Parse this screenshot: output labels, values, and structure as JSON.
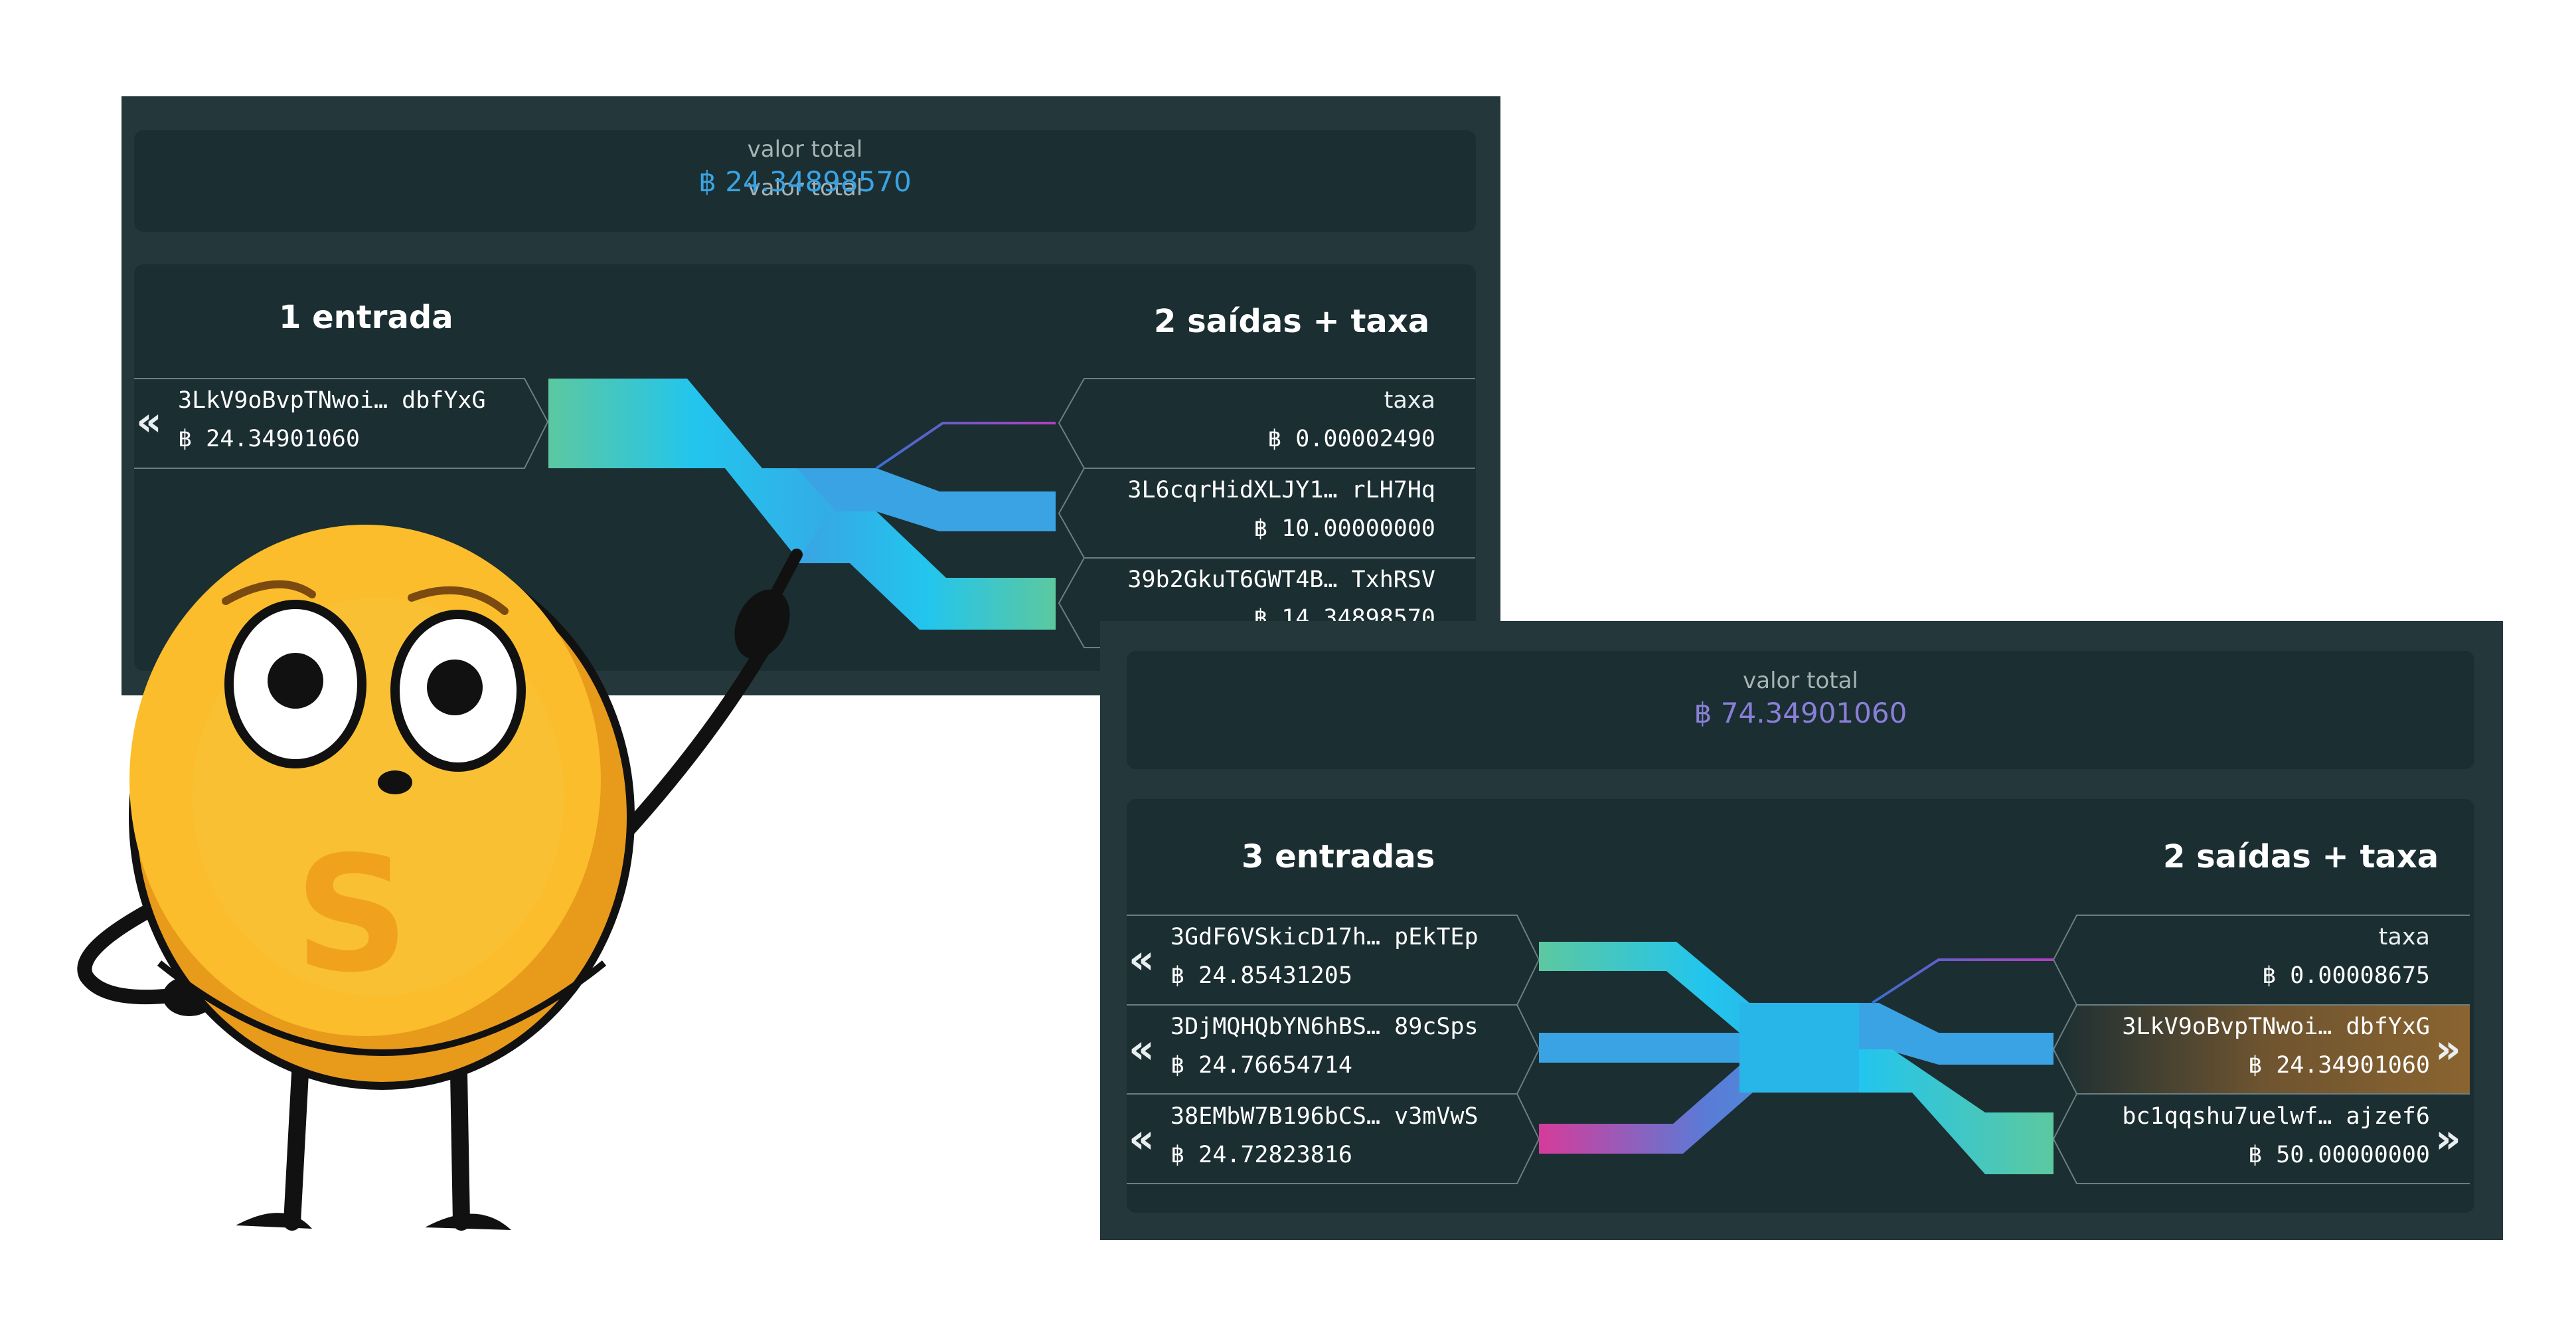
{
  "currency_symbol": "฿",
  "colors": {
    "panel_bg": "#24373b",
    "box_bg": "#1b2e32",
    "total_blue": "#3aa3e3",
    "total_purple": "#8a7fd8",
    "flow_green": "#5cc8a0",
    "flow_blue": "#3aa3e3",
    "flow_cyan": "#22c5ee",
    "flow_magenta": "#d63b9b",
    "highlight_row": "#8a6430",
    "coin_yellow": "#fbbd2b"
  },
  "tx1": {
    "total_label": "valor total",
    "total_value": "฿ 24.34898570",
    "inputs_title": "1 entrada",
    "outputs_title": "2 saídas + taxa",
    "inputs": [
      {
        "address": "3LkV9oBvpTNwoi… dbfYxG",
        "amount": "฿ 24.34901060"
      }
    ],
    "fee": {
      "label": "taxa",
      "amount": "฿ 0.00002490"
    },
    "outputs": [
      {
        "address": "3L6cqrHidXLJY1… rLH7Hq",
        "amount": "฿ 10.00000000"
      },
      {
        "address": "39b2GkuT6GWT4B… TxhRSV",
        "amount": "฿ 14.34898570"
      }
    ]
  },
  "tx2": {
    "total_label": "valor total",
    "total_value": "฿ 74.34901060",
    "inputs_title": "3 entradas",
    "outputs_title": "2 saídas + taxa",
    "inputs": [
      {
        "address": "3GdF6VSkicD17h… pEkTEp",
        "amount": "฿ 24.85431205"
      },
      {
        "address": "3DjMQHQbYN6hBS… 89cSps",
        "amount": "฿ 24.76654714"
      },
      {
        "address": "38EMbW7B196bCS… v3mVwS",
        "amount": "฿ 24.72823816"
      }
    ],
    "fee": {
      "label": "taxa",
      "amount": "฿ 0.00008675"
    },
    "outputs": [
      {
        "address": "3LkV9oBvpTNwoi… dbfYxG",
        "amount": "฿ 24.34901060",
        "highlighted": true
      },
      {
        "address": "bc1qqshu7uelwf… ajzef6",
        "amount": "฿ 50.00000000"
      }
    ]
  },
  "icons": {
    "input_chevron": "double-chevron-left-icon",
    "output_chevron": "double-chevron-right-icon",
    "mascot": "coin-mascot-pointing"
  }
}
